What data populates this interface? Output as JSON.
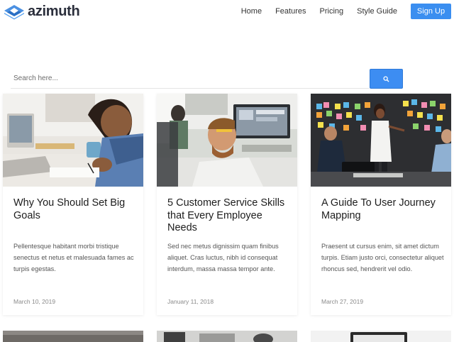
{
  "brand": {
    "name": "azimuth",
    "accent": "#3a8ef0"
  },
  "nav": {
    "items": [
      {
        "label": "Home"
      },
      {
        "label": "Features"
      },
      {
        "label": "Pricing"
      },
      {
        "label": "Style Guide"
      }
    ],
    "signup_label": "Sign Up"
  },
  "search": {
    "placeholder": "Search here...",
    "button_icon": "search-icon"
  },
  "cards": [
    {
      "title": "Why You Should Set Big Goals",
      "excerpt": "Pellentesque habitant morbi tristique senectus et netus et malesuada fames ac turpis egestas.",
      "date": "March 10, 2019"
    },
    {
      "title": "5 Customer Service Skills that Every Employee Needs",
      "excerpt": "Sed nec metus dignissim quam finibus aliquet. Cras luctus, nibh id consequat interdum, massa massa tempor ante.",
      "date": "January 11, 2018"
    },
    {
      "title": "A Guide To User Journey Mapping",
      "excerpt": "Praesent ut cursus enim, sit amet dictum turpis. Etiam justo orci, consectetur aliquet rhoncus sed, hendrerit vel odio.",
      "date": "March 27, 2019"
    }
  ]
}
